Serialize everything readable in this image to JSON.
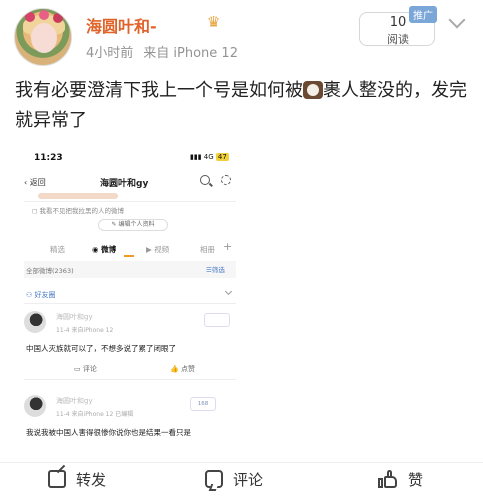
{
  "post": {
    "username": "海圆叶和-",
    "badge_icon": "crown-icon",
    "time": "4小时前",
    "source": "来自 iPhone 12",
    "read_count": "10",
    "read_label": "阅读",
    "ad_tag": "推广",
    "text_before_emoji": "我有必要澄清下我上一个号是如何被",
    "text_after_emoji": "裹人整没的，发完就异常了"
  },
  "screenshot": {
    "status_time": "11:23",
    "status_network": "4G",
    "status_battery": "47",
    "back_label": "返回",
    "profile_title": "海圆叶和gy",
    "hint_line": "我看不见把我拉黑的人的微博",
    "edit_button": "编辑个人资料",
    "tabs": [
      "精选",
      "微博",
      "视频",
      "相册"
    ],
    "all_weibo": "全部微博(2363)",
    "filter_label": "筛选",
    "friends_circle": "好友圈",
    "posts": [
      {
        "name": "海圆叶和gy",
        "meta": "11-4 来自iPhone 12",
        "body": "中国人灭族就可以了，不想多说了累了闭眼了",
        "comment_label": "评论",
        "like_label": "点赞"
      },
      {
        "name": "海圆叶和gy",
        "meta": "11-4 来自iPhone 12 已编辑",
        "stamp": "168",
        "body": "我说我被中国人害得很惨你说你也是结果一看只是"
      }
    ]
  },
  "actions": {
    "share": "转发",
    "comment": "评论",
    "like": "赞"
  },
  "colors": {
    "username": "#e0632a",
    "link_blue": "#4a7bc8",
    "ad_tag_bg": "#7aa6d8"
  }
}
